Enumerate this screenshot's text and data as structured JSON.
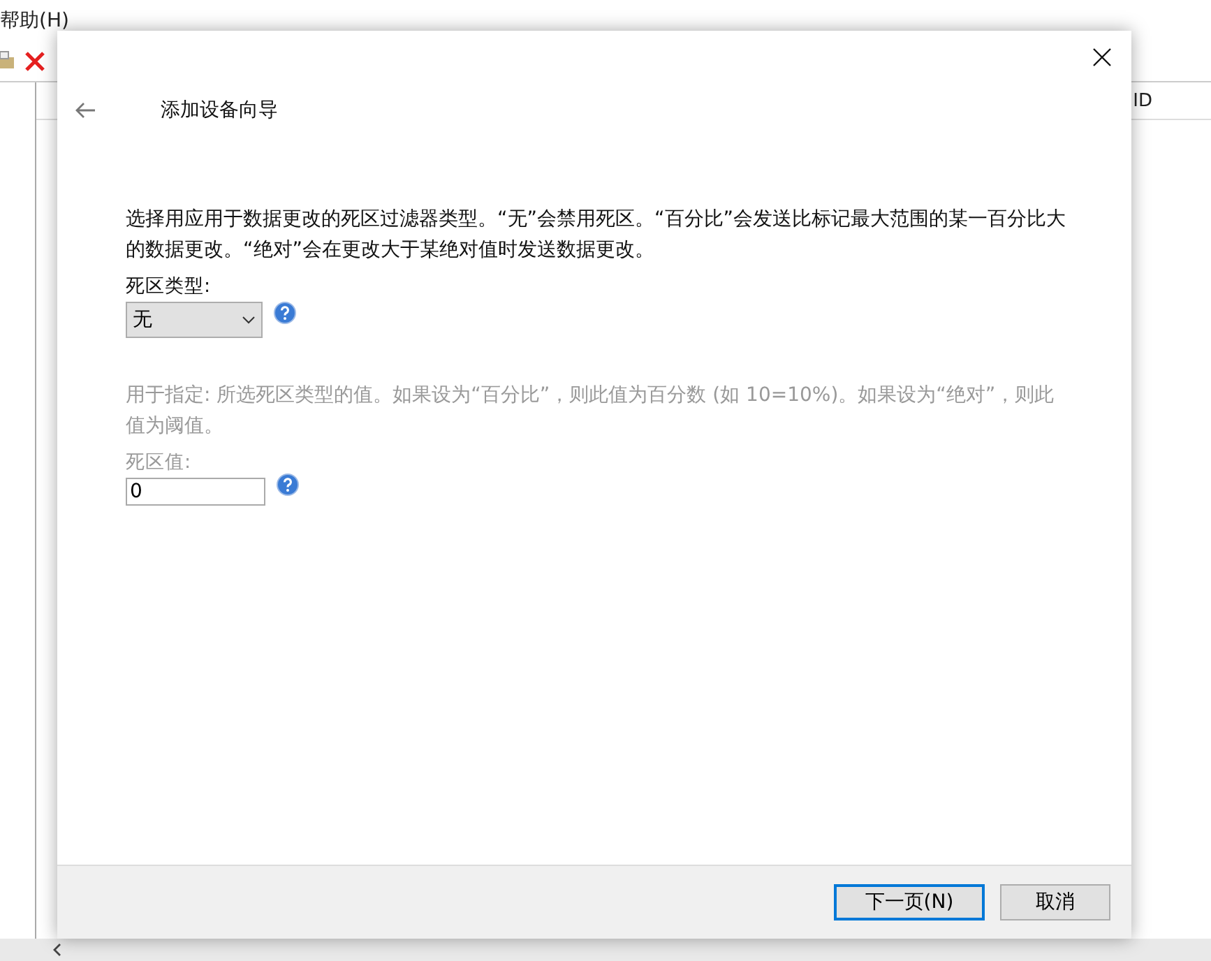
{
  "background_window": {
    "menu": [
      "帮助(H)"
    ],
    "column_header": "ID"
  },
  "dialog": {
    "title": "添加设备向导",
    "description": "选择用应用于数据更改的死区过滤器类型。“无”会禁用死区。“百分比”会发送比标记最大范围的某一百分比大的数据更改。“绝对”会在更改大于某绝对值时发送数据更改。",
    "type_label": "死区类型:",
    "type_value": "无",
    "value_section": {
      "disabled": true,
      "hint": "用于指定: 所选死区类型的值。如果设为“百分比”，则此值为百分数 (如 10=10%)。如果设为“绝对”，则此值为阈值。",
      "label": "死区值:",
      "value": "0"
    },
    "buttons": [
      {
        "label": "下一页(N)",
        "selected": true
      },
      {
        "label": "取消",
        "selected": false
      }
    ]
  }
}
